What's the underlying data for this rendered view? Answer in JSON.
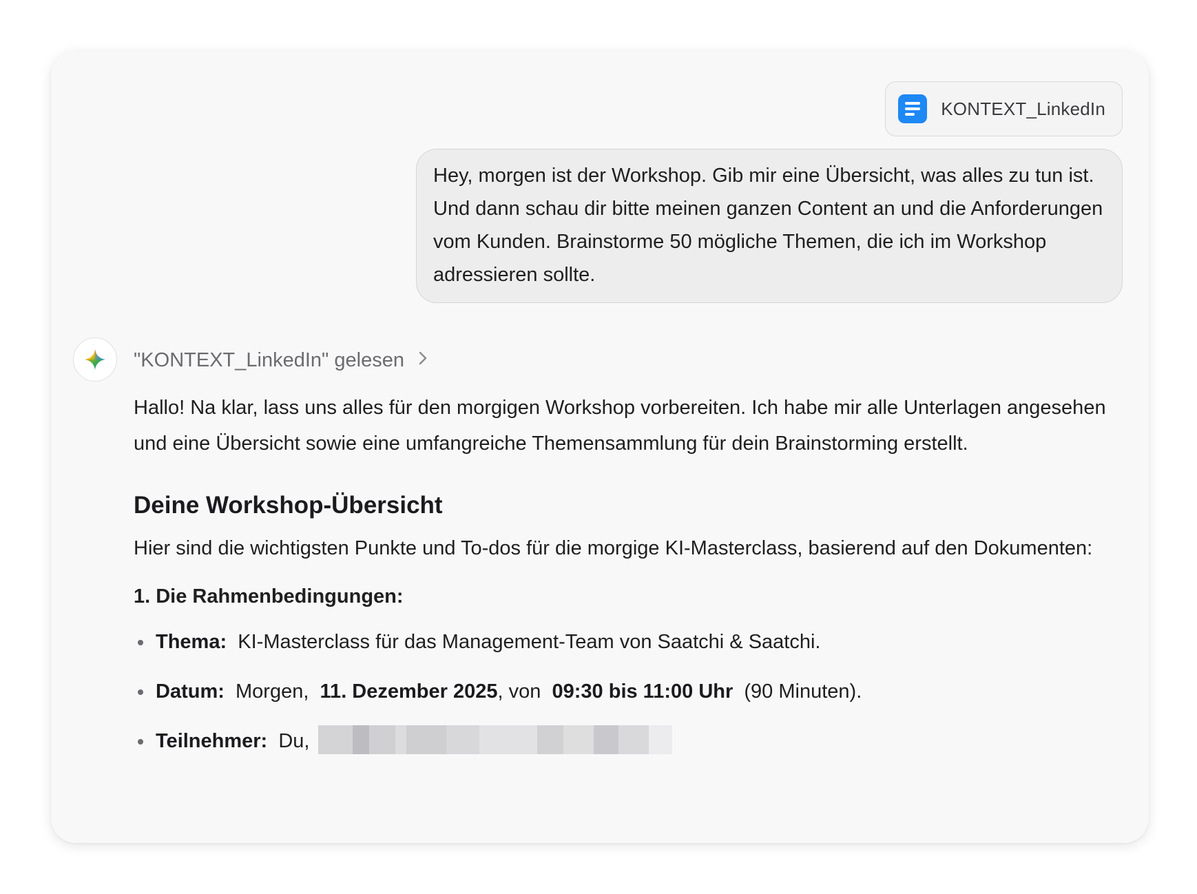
{
  "colors": {
    "accent_blue": "#1e88f5",
    "card_background": "#f8f8f9",
    "bubble_background": "#ededee"
  },
  "attachment": {
    "icon": "document-icon",
    "file_name": "KONTEXT_LinkedIn"
  },
  "user_message": {
    "text": "Hey, morgen ist der Workshop. Gib mir eine Übersicht, was alles zu tun ist. Und dann schau dir bitte meinen ganzen Content an und die Anforderungen vom Kunden. Brainstorme 50 mögliche Themen, die ich im Workshop adressieren sollte."
  },
  "assistant": {
    "avatar_icon": "sparkle-icon",
    "read_status": "\"KONTEXT_LinkedIn\" gelesen",
    "read_status_chevron_icon": "chevron-right-icon",
    "intro": "Hallo! Na klar, lass uns alles für den morgigen Workshop vorbereiten. Ich habe mir alle Unterlagen angesehen und eine Übersicht sowie eine umfangreiche Themensammlung für dein Brainstorming erstellt.",
    "heading": "Deine Workshop-Übersicht",
    "heading_intro": "Hier sind die wichtigsten Punkte und To-dos für die morgige KI-Masterclass, basierend auf den Dokumenten:",
    "section_title": "1. Die Rahmenbedingungen:",
    "bullets": {
      "thema_label": "Thema:",
      "thema_text": "KI-Masterclass für das Management-Team von Saatchi & Saatchi.",
      "datum_label": "Datum:",
      "datum_pre": "Morgen,",
      "datum_date": "11. Dezember 2025",
      "datum_mid": ", von",
      "datum_time": "09:30 bis 11:00 Uhr",
      "datum_post": "(90 Minuten).",
      "teilnehmer_label": "Teilnehmer:",
      "teilnehmer_text": "Du,"
    }
  }
}
